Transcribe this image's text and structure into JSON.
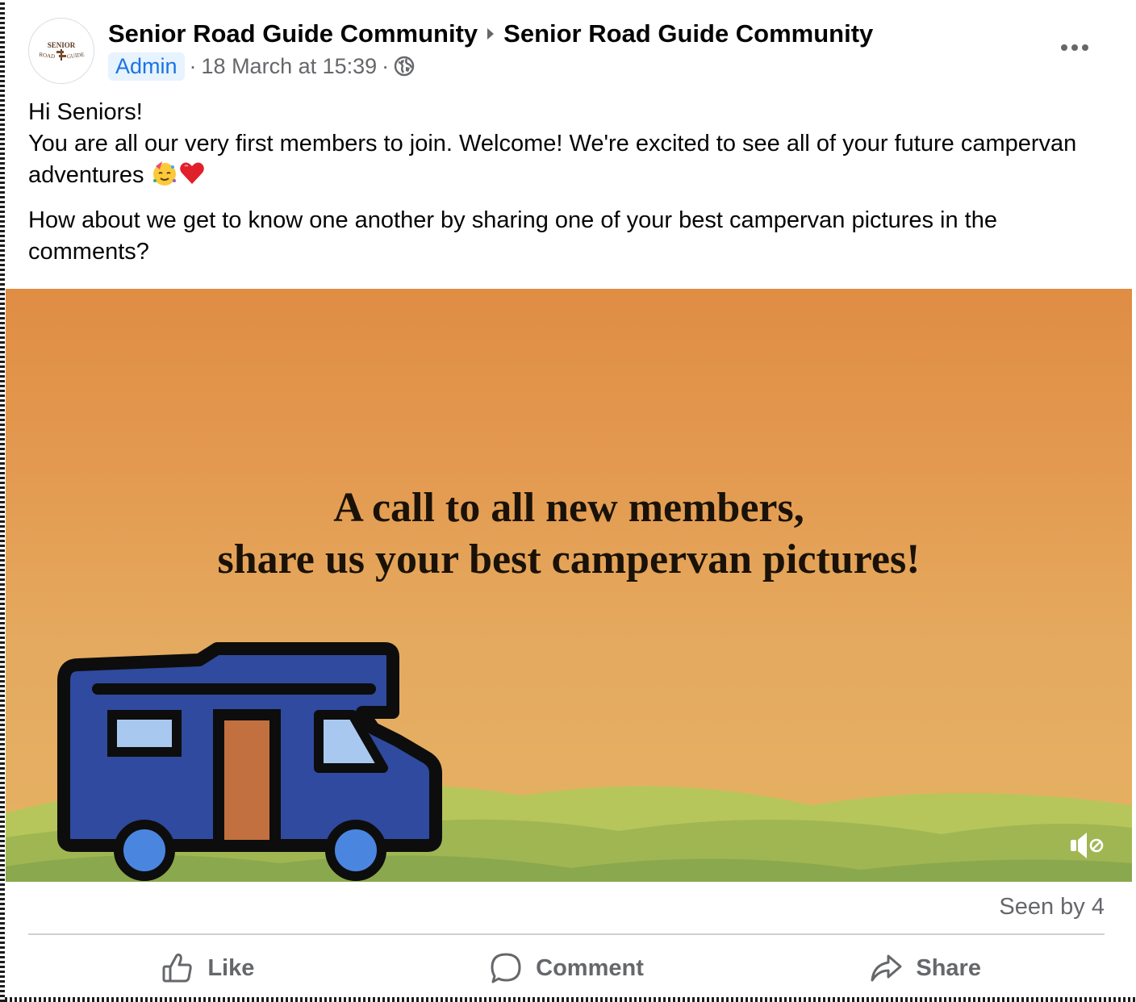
{
  "post": {
    "group_name": "Senior Road Guide Community",
    "posted_in": "Senior Road Guide Community",
    "author_badge": "Admin",
    "separator": "·",
    "timestamp": "18 March at 15:39",
    "avatar_logo": {
      "line1": "SENIOR",
      "line2_left": "ROAD",
      "line2_right": "GUIDE"
    },
    "body": {
      "line1": "Hi Seniors!",
      "line2": "You are all our very first members to join. Welcome! We're excited to see all of your future campervan adventures",
      "line3": "How about we get to know one another by sharing one of your best campervan pictures in the comments?"
    },
    "emojis": [
      "partying-face-icon",
      "red-heart-icon"
    ]
  },
  "media": {
    "headline_line1": "A call to all new members,",
    "headline_line2": "share us your best campervan pictures!",
    "colors": {
      "sky_top": "#e08d44",
      "sky_bottom": "#e6b264",
      "hills_light": "#b6c65a",
      "hills_dark": "#8aa84d",
      "van_body": "#2f4a9e",
      "van_window": "#a8c8ef",
      "van_door": "#c2703f",
      "van_wheel": "#4a86e0"
    }
  },
  "footer": {
    "seen_by": "Seen by 4",
    "actions": {
      "like": "Like",
      "comment": "Comment",
      "share": "Share"
    }
  },
  "theme": {
    "badge_text": "#1b74e4",
    "badge_bg": "#e7f3ff",
    "secondary_text": "#65676b",
    "divider": "#ced0d4"
  }
}
